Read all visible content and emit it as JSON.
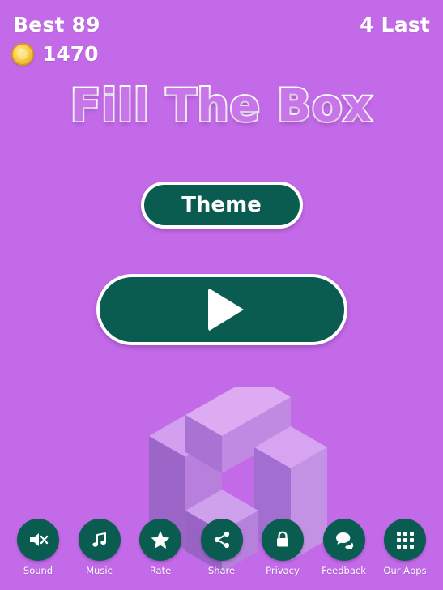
{
  "header": {
    "best_label": "Best 89",
    "last_label": "4 Last"
  },
  "coins": {
    "icon": "coin-icon",
    "amount": "1470"
  },
  "title": "Fill The Box",
  "buttons": {
    "theme_label": "Theme",
    "play_icon": "play-triangle-icon"
  },
  "artwork": {
    "name": "isometric-blocks-illustration",
    "colors": {
      "top": "#d9a8f0",
      "left": "#9a63c6",
      "right": "#bb8ae0",
      "shadow": "#a26fd0"
    }
  },
  "theme": {
    "background": "#c36ae8",
    "accent": "#0b5c50",
    "text": "#ffffff",
    "coin": "#f7cf45"
  },
  "bottom_bar": [
    {
      "label": "Sound",
      "icon": "sound-muted-icon"
    },
    {
      "label": "Music",
      "icon": "music-note-icon"
    },
    {
      "label": "Rate",
      "icon": "star-icon"
    },
    {
      "label": "Share",
      "icon": "share-icon"
    },
    {
      "label": "Privacy",
      "icon": "lock-icon"
    },
    {
      "label": "Feedback",
      "icon": "chat-bubble-icon"
    },
    {
      "label": "Our Apps",
      "icon": "grid-apps-icon"
    }
  ]
}
